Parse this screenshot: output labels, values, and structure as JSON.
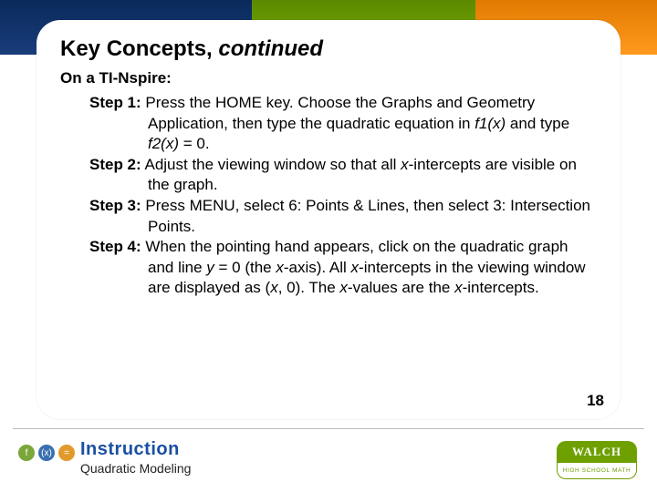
{
  "header": {
    "title_main": "Key Concepts, ",
    "title_cont": "continued"
  },
  "body": {
    "subhead": "On a TI-Nspire:",
    "steps": [
      {
        "label": "Step 1:",
        "text_html": "Press the HOME key. Choose the Graphs and Geometry Application, then type the quadratic equation in <span class='ital'>f1(x)</span> and type <span class='ital'>f2(x)</span> = 0."
      },
      {
        "label": "Step 2:",
        "text_html": "Adjust the viewing window so that all <span class='ital'>x</span>-intercepts are visible on the graph."
      },
      {
        "label": "Step 3:",
        "text_html": "Press MENU, select 6: Points & Lines, then select 3: Intersection Points."
      },
      {
        "label": "Step 4:",
        "text_html": "When the pointing hand appears, click on the quadratic graph and line <span class='ital'>y</span> = 0 (the <span class='ital'>x</span>-axis). All <span class='ital'>x</span>-intercepts in the viewing window are displayed as (<span class='ital'>x</span>, 0). The <span class='ital'>x</span>-values are the <span class='ital'>x</span>-intercepts."
      }
    ],
    "page_number": "18"
  },
  "footer": {
    "instruction_label": "Instruction",
    "subtitle": "Quadratic Modeling",
    "badges": {
      "b1": "f",
      "b2": "(x)",
      "b3": "="
    },
    "logo": {
      "name": "WALCH",
      "tagline": "HIGH SCHOOL MATH"
    }
  }
}
